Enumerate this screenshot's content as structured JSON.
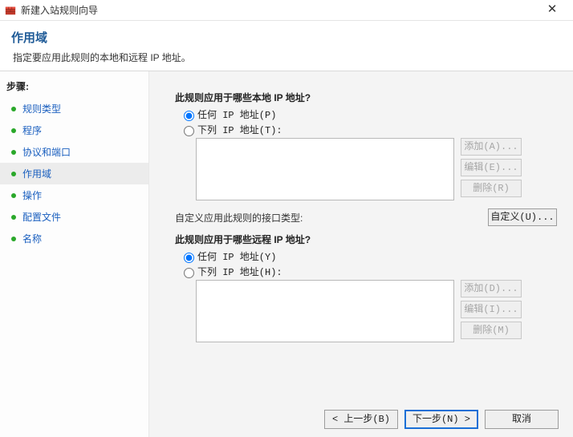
{
  "titlebar": {
    "title": "新建入站规则向导"
  },
  "header": {
    "title": "作用域",
    "subtitle": "指定要应用此规则的本地和远程 IP 地址。"
  },
  "sidebar": {
    "header": "步骤:",
    "items": [
      {
        "label": "规则类型"
      },
      {
        "label": "程序"
      },
      {
        "label": "协议和端口"
      },
      {
        "label": "作用域"
      },
      {
        "label": "操作"
      },
      {
        "label": "配置文件"
      },
      {
        "label": "名称"
      }
    ],
    "activeIndex": 3
  },
  "content": {
    "local": {
      "question": "此规则应用于哪些本地 IP 地址?",
      "optAny": "任何 IP 地址(P)",
      "optList": "下列 IP 地址(T):",
      "btnAdd": "添加(A)...",
      "btnEdit": "编辑(E)...",
      "btnDel": "删除(R)"
    },
    "iface": {
      "label": "自定义应用此规则的接口类型:",
      "btn": "自定义(U)..."
    },
    "remote": {
      "question": "此规则应用于哪些远程 IP 地址?",
      "optAny": "任何 IP 地址(Y)",
      "optList": "下列 IP 地址(H):",
      "btnAdd": "添加(D)...",
      "btnEdit": "编辑(I)...",
      "btnDel": "删除(M)"
    }
  },
  "footer": {
    "back": "< 上一步(B)",
    "next": "下一步(N) >",
    "cancel": "取消"
  }
}
